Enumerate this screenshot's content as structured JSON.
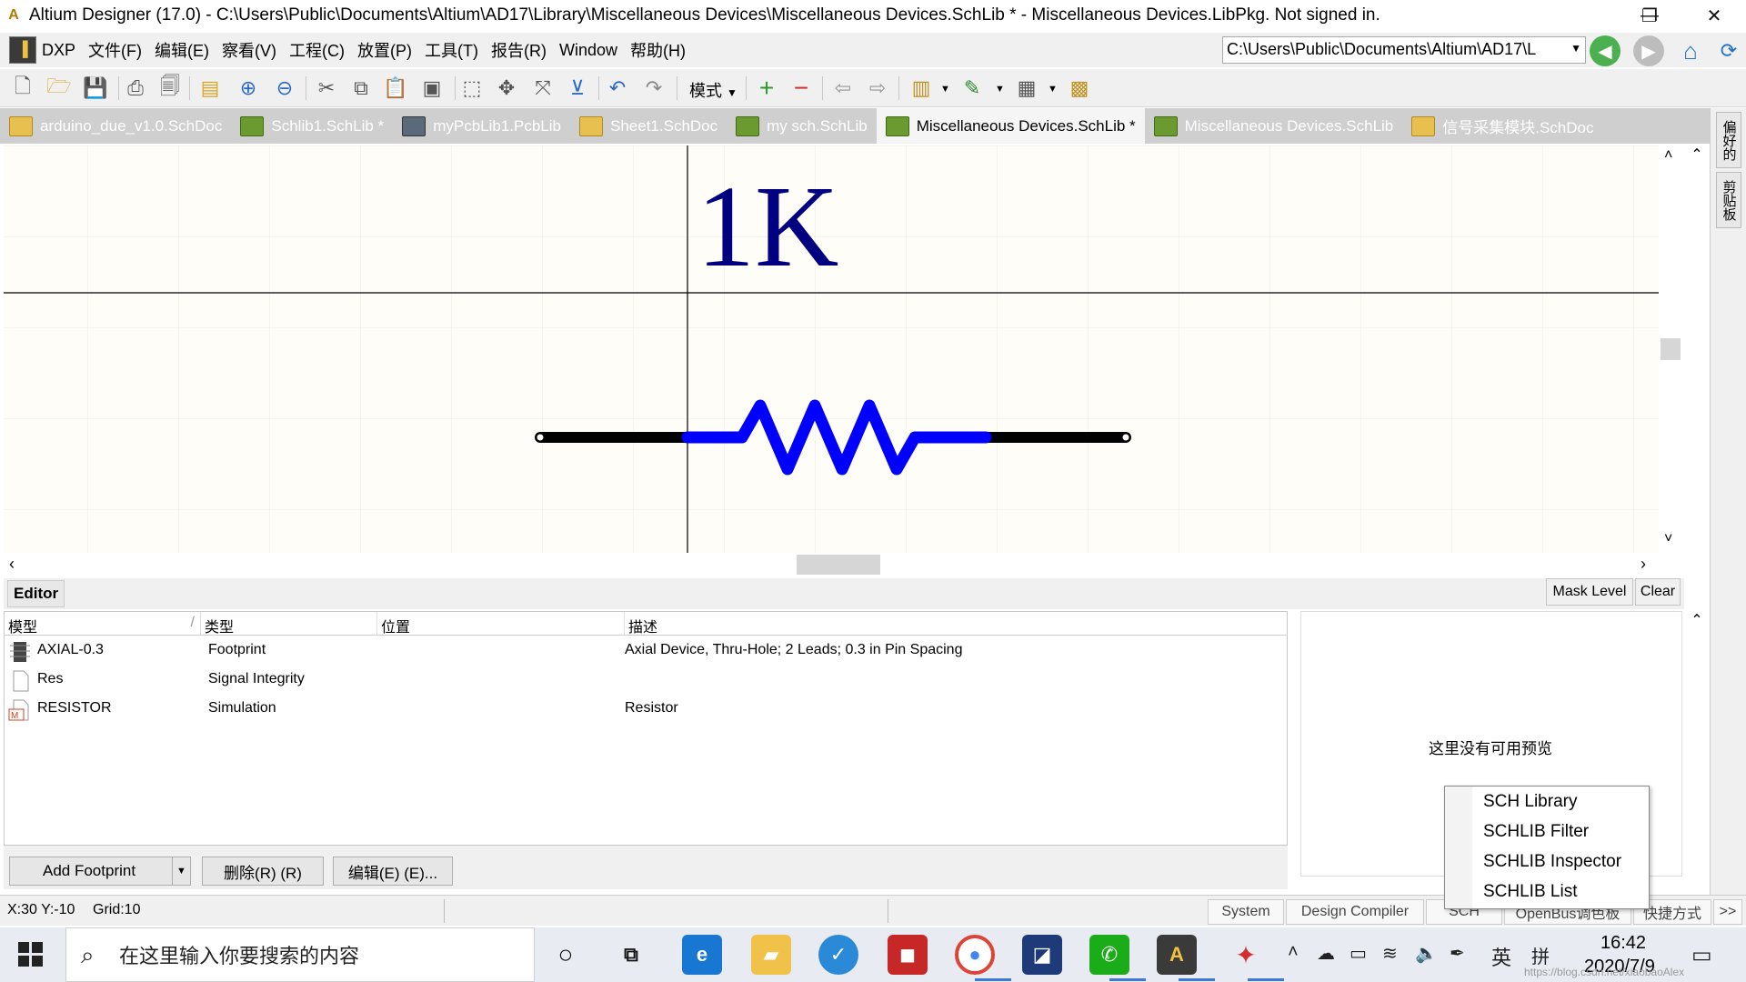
{
  "window": {
    "title": "Altium Designer (17.0) - C:\\Users\\Public\\Documents\\Altium\\AD17\\Library\\Miscellaneous Devices\\Miscellaneous Devices.SchLib * - Miscellaneous Devices.LibPkg. Not signed in.",
    "minimize": "—",
    "restore": "❐",
    "close": "✕"
  },
  "menubar": {
    "items": [
      "DXP",
      "文件(F)",
      "编辑(E)",
      "察看(V)",
      "工程(C)",
      "放置(P)",
      "工具(T)",
      "报告(R)",
      "Window",
      "帮助(H)"
    ],
    "path": "C:\\Users\\Public\\Documents\\Altium\\AD17\\L"
  },
  "toolbar": {
    "mode_label": "模式"
  },
  "tabs": [
    {
      "label": "arduino_due_v1.0.SchDoc",
      "icon": "folder-icon"
    },
    {
      "label": "Schlib1.SchLib *",
      "icon": "chip-icon"
    },
    {
      "label": "myPcbLib1.PcbLib",
      "icon": "pcb-icon"
    },
    {
      "label": "Sheet1.SchDoc",
      "icon": "folder-icon"
    },
    {
      "label": "my sch.SchLib",
      "icon": "chip-icon"
    },
    {
      "label": "Miscellaneous Devices.SchLib *",
      "icon": "chip-icon",
      "active": true
    },
    {
      "label": "Miscellaneous Devices.SchLib",
      "icon": "chip-icon"
    },
    {
      "label": "信号采集模块.SchDoc",
      "icon": "folder-icon"
    }
  ],
  "rightdock": {
    "tabs": [
      "偏好的",
      "剪贴板"
    ]
  },
  "canvas": {
    "component_value": "1K",
    "colors": {
      "background": "#fffdf7",
      "pin": "#000000",
      "body": "#0000ff",
      "text": "#000080"
    }
  },
  "editor": {
    "label": "Editor",
    "mask_level": "Mask Level",
    "clear": "Clear",
    "columns": [
      "模型",
      "类型",
      "位置",
      "描述"
    ],
    "rows": [
      {
        "model": "AXIAL-0.3",
        "type": "Footprint",
        "location": "",
        "description": "Axial Device, Thru-Hole; 2 Leads; 0.3 in Pin Spacing",
        "icon": "footprint-icon"
      },
      {
        "model": "Res",
        "type": "Signal Integrity",
        "location": "",
        "description": "",
        "icon": "document-icon"
      },
      {
        "model": "RESISTOR",
        "type": "Simulation",
        "location": "",
        "description": "Resistor",
        "icon": "simulation-model-icon"
      }
    ],
    "preview_text": "这里没有可用预览",
    "buttons": {
      "add_footprint": "Add Footprint",
      "delete": "删除(R) (R)",
      "edit": "编辑(E) (E)..."
    }
  },
  "popup_menu": {
    "items": [
      "SCH Library",
      "SCHLIB Filter",
      "SCHLIB Inspector",
      "SCHLIB List"
    ]
  },
  "statusbar": {
    "coords": "X:30 Y:-10",
    "grid": "Grid:10",
    "tabs": [
      "System",
      "Design Compiler",
      "SCH",
      "OpenBus调色板",
      "快捷方式"
    ],
    "more": ">>"
  },
  "taskbar": {
    "search_placeholder": "在这里输入你要搜索的内容",
    "ime": "英",
    "ime2": "拼",
    "time": "16:42",
    "date": "2020/7/9",
    "watermark": "https://blog.csdn.net/xiaobaoAlex"
  }
}
